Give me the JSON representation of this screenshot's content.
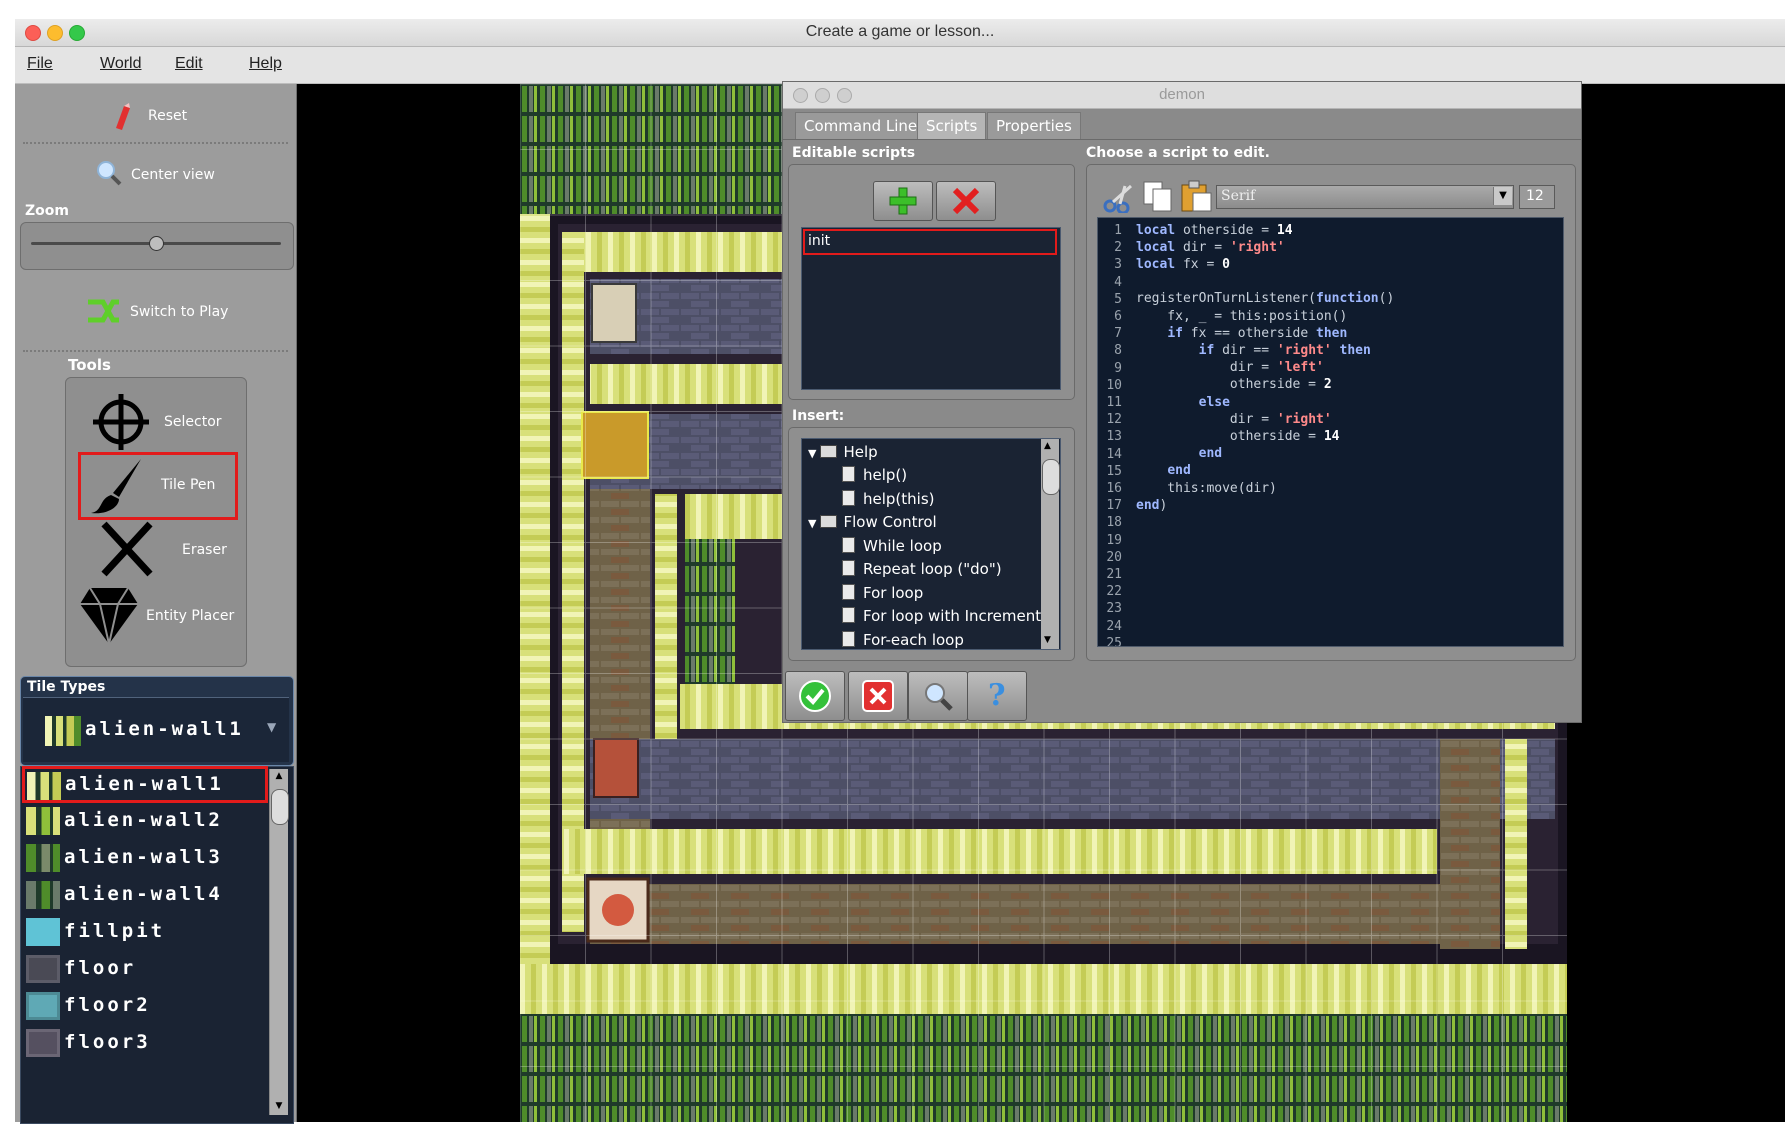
{
  "window": {
    "title": "Create a game or lesson..."
  },
  "menu": [
    "File",
    "World",
    "Edit",
    "Help"
  ],
  "left": {
    "reset": "Reset",
    "center_view": "Center view",
    "zoom_label": "Zoom",
    "switch_play": "Switch to Play",
    "tools_label": "Tools",
    "tools": [
      "Selector",
      "Tile Pen",
      "Eraser",
      "Entity Placer"
    ],
    "tile_types_label": "Tile Types",
    "selected_tile": "alien-wall1",
    "tiles": [
      "alien-wall1",
      "alien-wall2",
      "alien-wall3",
      "alien-wall4",
      "fillpit",
      "floor",
      "floor2",
      "floor3"
    ]
  },
  "dialog": {
    "title": "demon",
    "tabs": [
      "Command Line",
      "Scripts",
      "Properties"
    ],
    "editable_scripts_label": "Editable scripts",
    "script_item": "init",
    "insert_label": "Insert:",
    "tree": [
      "Help",
      "help()",
      "help(this)",
      "Flow Control",
      "While loop",
      "Repeat loop (\"do\")",
      "For loop",
      "For loop with Increment",
      "For-each loop"
    ],
    "choose_label": "Choose a script to edit.",
    "font_select": "Serif",
    "font_size": "12",
    "line_numbers": [
      "1",
      "2",
      "3",
      "4",
      "5",
      "6",
      "7",
      "8",
      "9",
      "10",
      "11",
      "12",
      "13",
      "14",
      "15",
      "16",
      "17",
      "18",
      "19",
      "20",
      "21",
      "22",
      "23",
      "24",
      "25"
    ]
  },
  "colors": {
    "selection": "#e21b1b",
    "code_bg": "#0f1b2d",
    "panel": "#9c9c9c"
  }
}
